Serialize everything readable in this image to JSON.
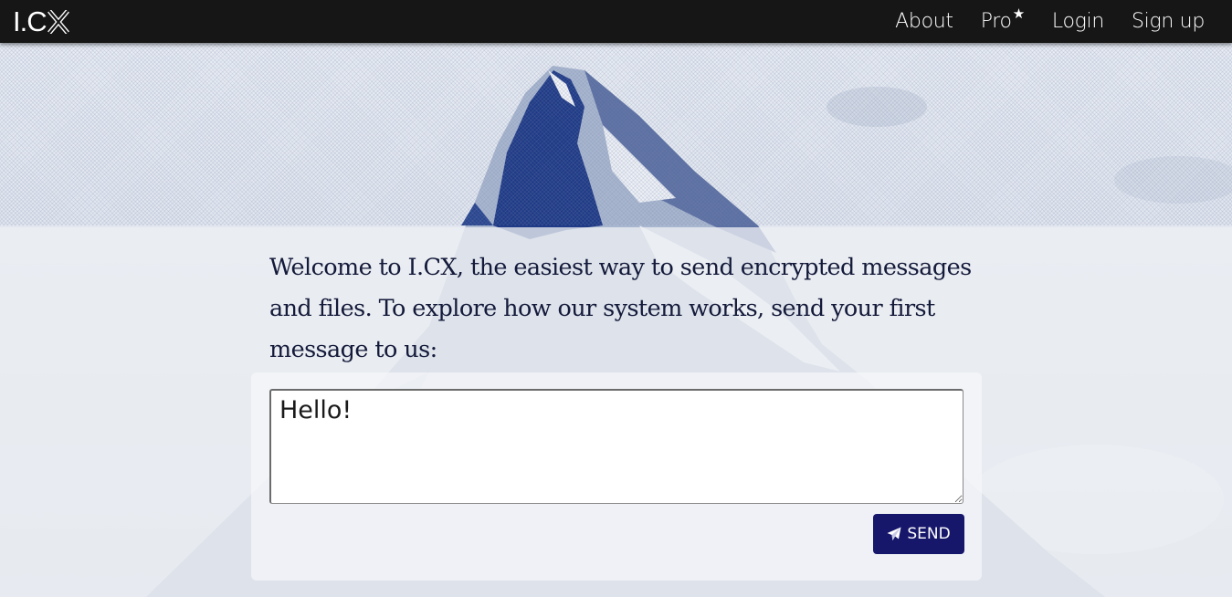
{
  "header": {
    "logo_text": "I.C",
    "logo_mark": "X",
    "nav": [
      {
        "label": "About"
      },
      {
        "label": "Pro",
        "badge_icon": "star-icon",
        "badge_glyph": "★"
      },
      {
        "label": "Login"
      },
      {
        "label": "Sign up"
      }
    ]
  },
  "main": {
    "intro_text": "Welcome to I.CX, the easiest way to send encrypted messages and files. To explore how our system works, send your first message to us:",
    "message": {
      "value": "Hello!"
    },
    "send_button": {
      "label": "SEND",
      "icon": "paper-plane-icon"
    }
  },
  "colors": {
    "navbar": "#161616",
    "send_button": "#16166b",
    "intro_text": "#141a3a",
    "mountain_dark": "#1e3a8a"
  }
}
